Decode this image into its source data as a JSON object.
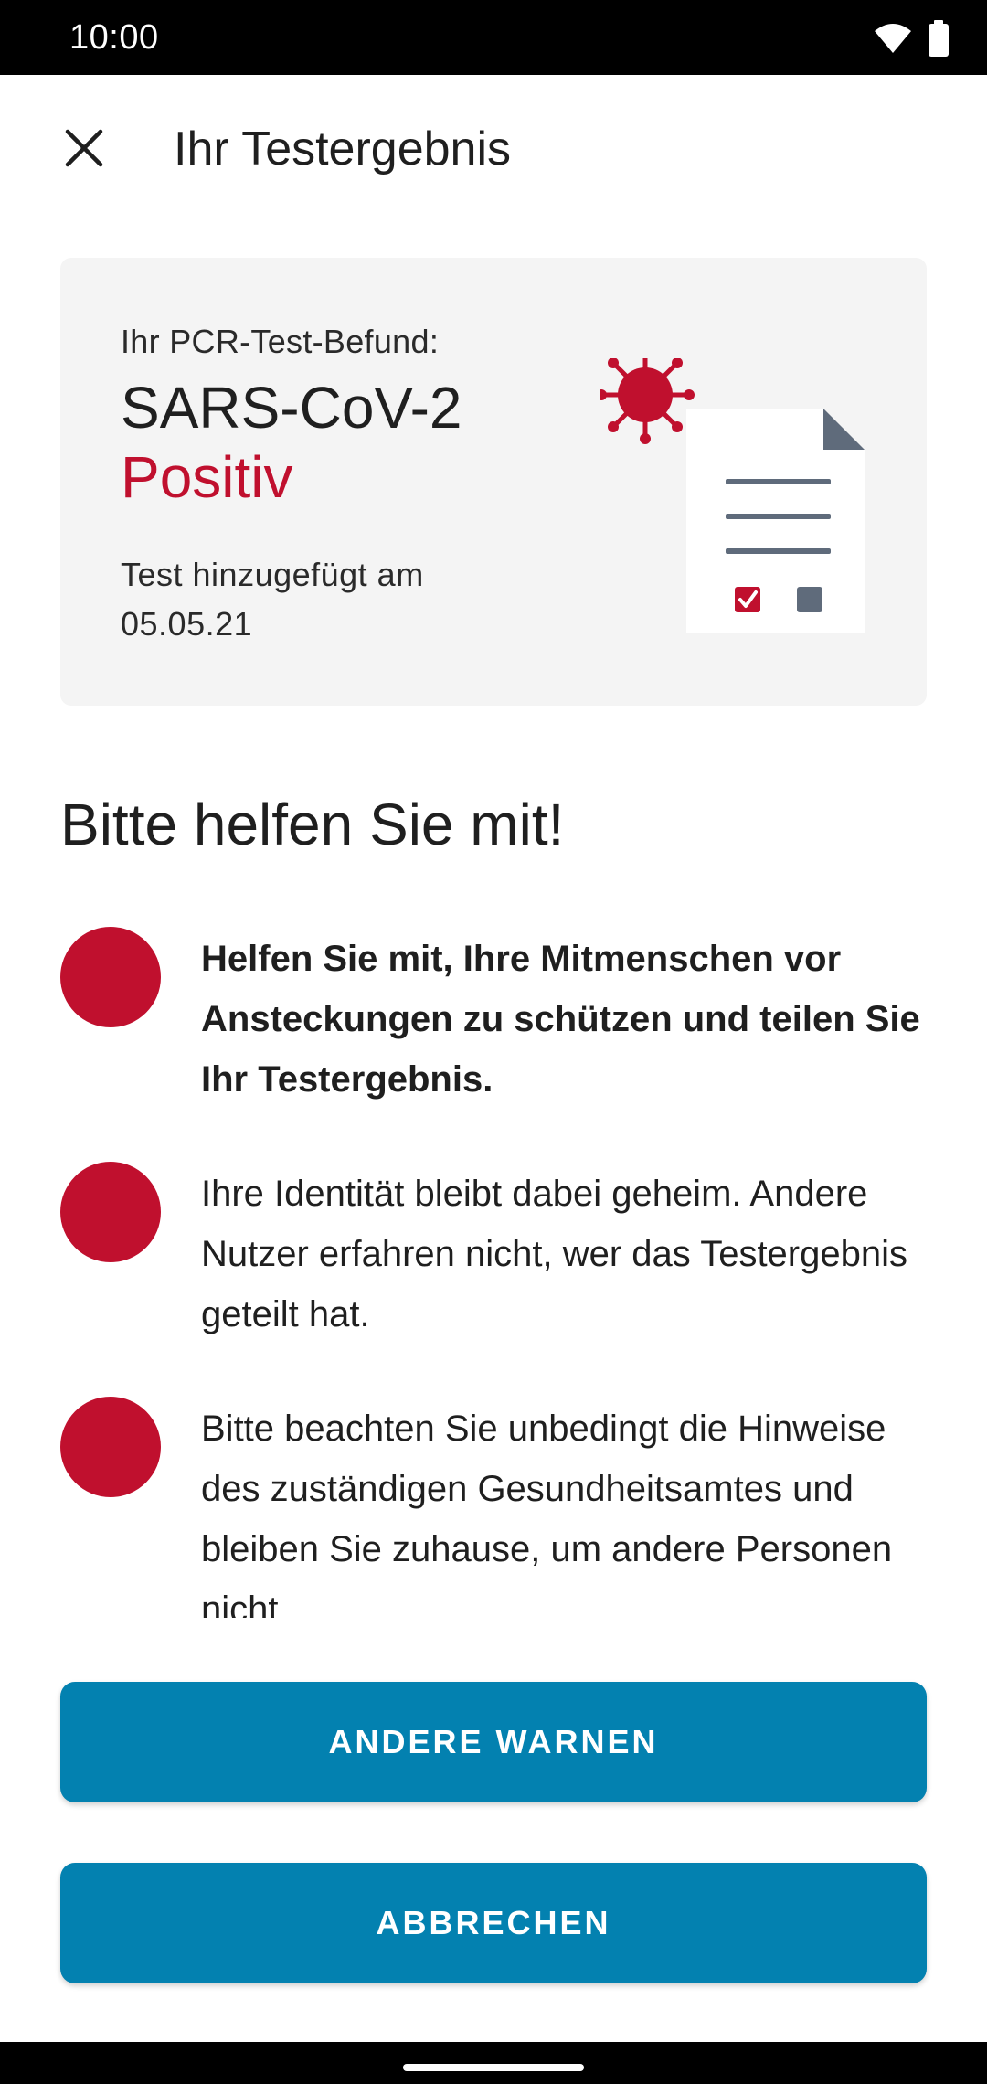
{
  "status_bar": {
    "time": "10:00",
    "icons": [
      "wifi-icon",
      "battery-icon"
    ]
  },
  "app_bar": {
    "close_icon": "close-icon",
    "title": "Ihr Testergebnis"
  },
  "result_card": {
    "label": "Ihr PCR-Test-Befund:",
    "virus_name": "SARS-CoV-2",
    "result": "Positiv",
    "date_label": "Test hinzugefügt am",
    "date": "05.05.21",
    "illustration": "virus-document-icon"
  },
  "section": {
    "title": "Bitte helfen Sie mit!"
  },
  "info_items": [
    {
      "text": "Helfen Sie mit, Ihre Mitmenschen vor Ansteckungen zu schützen und teilen Sie Ihr Testergebnis.",
      "bold": true
    },
    {
      "text": "Ihre Identität bleibt dabei geheim. Andere Nutzer erfahren nicht, wer das Testergebnis geteilt hat.",
      "bold": false
    },
    {
      "text": "Bitte beachten Sie unbedingt die Hinweise des zuständigen Gesundheitsamtes und bleiben Sie zuhause, um andere Personen nicht",
      "bold": false
    }
  ],
  "buttons": {
    "warn": "ANDERE WARNEN",
    "cancel": "ABBRECHEN"
  },
  "colors": {
    "accent": "#0381b0",
    "positive_red": "#c0102e",
    "card_background": "#f4f4f4",
    "status_bar": "#000000"
  }
}
